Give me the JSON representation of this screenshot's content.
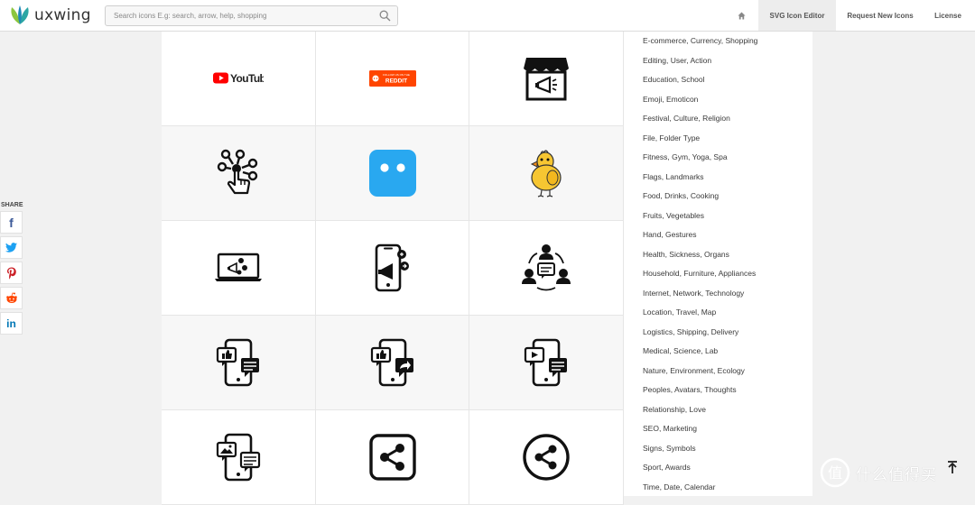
{
  "brand": {
    "name": "uxwing"
  },
  "search": {
    "placeholder": "Search icons E.g: search, arrow, help, shopping"
  },
  "nav": {
    "home_icon": "home-icon",
    "editor_label": "SVG Icon Editor",
    "request_label": "Request New Icons",
    "license_label": "License"
  },
  "share": {
    "label": "SHARE",
    "buttons": [
      {
        "icon": "facebook-icon",
        "glyph": "f",
        "color": "#3b5998"
      },
      {
        "icon": "twitter-icon",
        "glyph": "t",
        "color": "#1da1f2"
      },
      {
        "icon": "pinterest-icon",
        "glyph": "p",
        "color": "#cb2027"
      },
      {
        "icon": "reddit-icon",
        "glyph": "r",
        "color": "#ff4500"
      },
      {
        "icon": "linkedin-icon",
        "glyph": "in",
        "color": "#0077b5"
      }
    ]
  },
  "icons": [
    {
      "name": "youtube-logo-icon",
      "text": "YouTube"
    },
    {
      "name": "reddit-follow-button-icon",
      "text": "REDDIT",
      "small_text": "FOLLOW US ON THE"
    },
    {
      "name": "shop-promotion-icon"
    },
    {
      "name": "network-touch-icon"
    },
    {
      "name": "chat-robot-app-icon"
    },
    {
      "name": "chick-bird-icon"
    },
    {
      "name": "laptop-marketing-icon"
    },
    {
      "name": "mobile-marketing-icon"
    },
    {
      "name": "team-communication-icon"
    },
    {
      "name": "mobile-like-comment-icon"
    },
    {
      "name": "mobile-like-share-icon"
    },
    {
      "name": "mobile-video-comment-icon"
    },
    {
      "name": "mobile-image-comment-icon"
    },
    {
      "name": "share-square-icon"
    },
    {
      "name": "share-circle-icon"
    }
  ],
  "categories": [
    "E-commerce, Currency, Shopping",
    "Editing, User, Action",
    "Education, School",
    "Emoji, Emoticon",
    "Festival, Culture, Religion",
    "File, Folder Type",
    "Fitness, Gym, Yoga, Spa",
    "Flags, Landmarks",
    "Food, Drinks, Cooking",
    "Fruits, Vegetables",
    "Hand, Gestures",
    "Health, Sickness, Organs",
    "Household, Furniture, Appliances",
    "Internet, Network, Technology",
    "Location, Travel, Map",
    "Logistics, Shipping, Delivery",
    "Medical, Science, Lab",
    "Nature, Environment, Ecology",
    "Peoples, Avatars, Thoughts",
    "Relationship, Love",
    "SEO, Marketing",
    "Signs, Symbols",
    "Sport, Awards",
    "Time, Date, Calendar"
  ],
  "watermark": {
    "text": "什么值得买"
  },
  "colors": {
    "youtube_red": "#ff0000",
    "reddit_orange": "#ff4500",
    "robot_blue": "#29a8f0",
    "chick_yellow": "#f6c632"
  }
}
